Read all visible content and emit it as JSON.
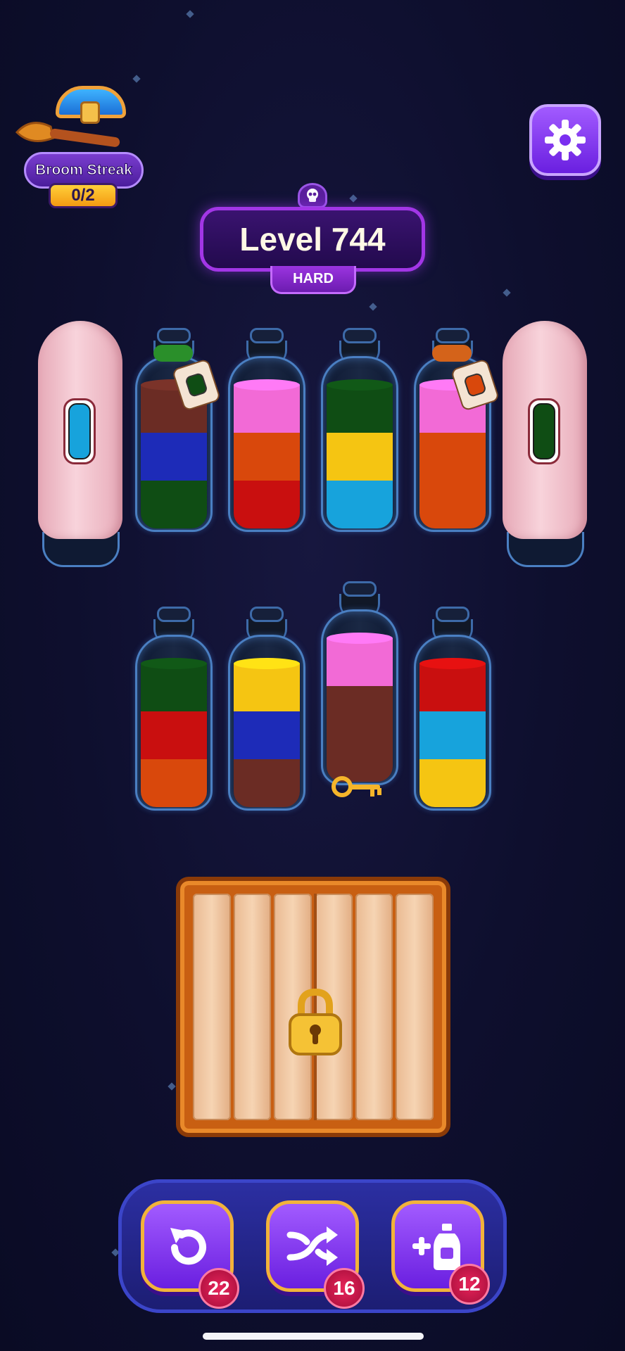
{
  "streak": {
    "label": "Broom Streak",
    "count": "0/2"
  },
  "level": {
    "title": "Level 744",
    "difficulty": "HARD"
  },
  "colors": {
    "brown": "#6b2c24",
    "blue": "#1d2bb8",
    "green": "#0f4d14",
    "pink": "#f26ad6",
    "orange": "#d9480c",
    "red": "#c90f0f",
    "yellow": "#f5c512",
    "cyan": "#17a3dc"
  },
  "bottles": [
    {
      "id": "b1",
      "state": "covered",
      "hint_color": "cyan"
    },
    {
      "id": "b2",
      "state": "tied",
      "tag_color": "green",
      "layers_top_to_bottom": [
        "brown",
        "blue",
        "green"
      ]
    },
    {
      "id": "b3",
      "layers_top_to_bottom": [
        "pink",
        "orange",
        "red"
      ]
    },
    {
      "id": "b4",
      "layers_top_to_bottom": [
        "green",
        "yellow",
        "cyan"
      ]
    },
    {
      "id": "b5",
      "state": "tied",
      "tag_color": "orange",
      "layers_top_to_bottom": [
        "pink",
        "orange",
        "orange"
      ]
    },
    {
      "id": "b6",
      "state": "covered",
      "hint_color": "green"
    },
    {
      "id": "b7",
      "layers_top_to_bottom": [
        "green",
        "red",
        "orange"
      ]
    },
    {
      "id": "b8",
      "layers_top_to_bottom": [
        "yellow",
        "blue",
        "brown"
      ]
    },
    {
      "id": "b9",
      "layers_top_to_bottom": [
        "pink",
        "brown",
        "brown"
      ],
      "contains": "key"
    },
    {
      "id": "b10",
      "layers_top_to_bottom": [
        "red",
        "cyan",
        "yellow"
      ]
    }
  ],
  "tools": {
    "undo": {
      "icon": "undo-icon",
      "count": "22"
    },
    "shuffle": {
      "icon": "shuffle-icon",
      "count": "16"
    },
    "add_bottle": {
      "icon": "add-bottle-icon",
      "count": "12"
    }
  }
}
